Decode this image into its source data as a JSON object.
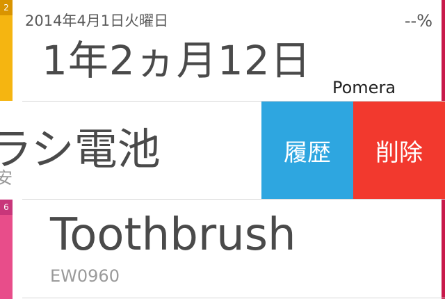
{
  "colors": {
    "row1_stripe": "#f5b511",
    "row3_stripe": "#e84d8a",
    "history_button": "#2ea6e0",
    "delete_button": "#f2392e",
    "right_edge": "#c8194a"
  },
  "items": [
    {
      "badge": "2",
      "date": "2014年4月1日火曜日",
      "percent": "--%",
      "duration": "1年2ヵ月12日",
      "subtitle": "Pomera"
    },
    {
      "name": "ラシ電池",
      "sub": "安",
      "actions": {
        "history": "履歴",
        "delete": "削除"
      }
    },
    {
      "badge": "6",
      "name": "Toothbrush",
      "sub": "EW0960"
    }
  ]
}
